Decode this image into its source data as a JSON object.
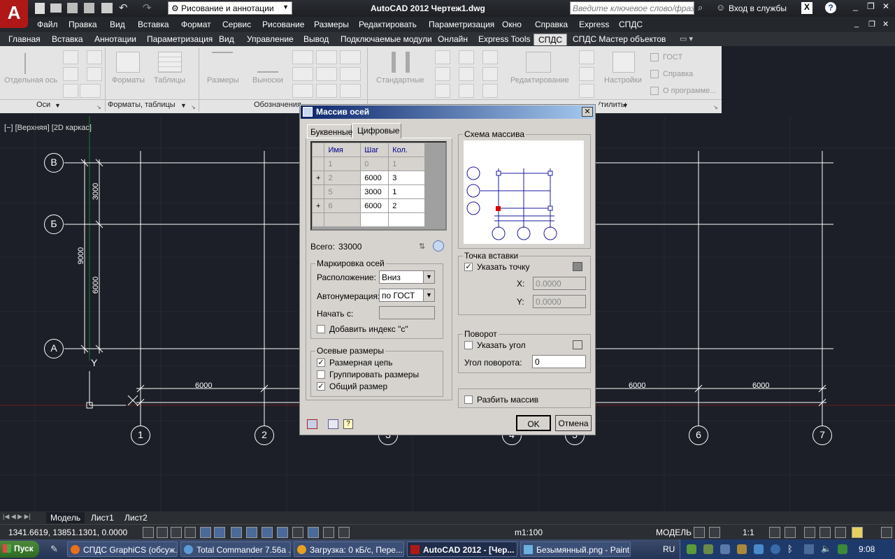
{
  "app": {
    "title": "AutoCAD 2012   Чертеж1.dwg",
    "workspace": "Рисование и аннотации",
    "search_placeholder": "Введите ключевое слово/фразу",
    "login": "Вход в службы"
  },
  "menu": [
    "Файл",
    "Правка",
    "Вид",
    "Вставка",
    "Формат",
    "Сервис",
    "Рисование",
    "Размеры",
    "Редактировать",
    "Параметризация",
    "Окно",
    "Справка",
    "Express",
    "СПДС"
  ],
  "ribbon_tabs": [
    "Главная",
    "Вставка",
    "Аннотации",
    "Параметризация",
    "Вид",
    "Управление",
    "Вывод",
    "Подключаемые модули",
    "Онлайн",
    "Express Tools",
    "СПДС",
    "СПДС Мастер объектов"
  ],
  "ribbon": {
    "buttons": {
      "axis": "Отдельная ось",
      "formats": "Форматы",
      "tables": "Таблицы",
      "dims": "Размеры",
      "leaders": "Выноски",
      "standard": "Стандартные",
      "edit": "Редактирование",
      "settings": "Настройки",
      "gost": "ГОСТ",
      "help": "Справка",
      "about": "О программе..."
    },
    "panels": [
      "Оси",
      "Форматы, таблицы",
      "Обозначения",
      "Утилиты"
    ]
  },
  "viewport_label": "[−] [Верхняя] [2D каркас]",
  "drawing": {
    "row_axes": [
      "В",
      "Б",
      "А"
    ],
    "col_axes": [
      "1",
      "2",
      "3",
      "4",
      "5",
      "6",
      "7"
    ],
    "dim_texts": [
      "6000",
      "6000",
      "6000"
    ],
    "vert_dims": [
      "3000",
      "6000",
      "9000"
    ],
    "ucs_y": "Y"
  },
  "layout_tabs": [
    "Модель",
    "Лист1",
    "Лист2"
  ],
  "status": {
    "coords": "1341.6619, 13851.1301, 0.0000",
    "scale_label": "m1:100",
    "model": "МОДЕЛЬ",
    "anno_scale": "1:1"
  },
  "dialog": {
    "title": "Массив осей",
    "tabs": [
      "Буквенные",
      "Цифровые"
    ],
    "grid": {
      "headers": [
        "Имя",
        "Шаг",
        "Кол."
      ],
      "rows": [
        {
          "expand": "",
          "name": "1",
          "step": "0",
          "count": "1"
        },
        {
          "expand": "+",
          "name": "2",
          "step": "6000",
          "count": "3"
        },
        {
          "expand": "",
          "name": "5",
          "step": "3000",
          "count": "1"
        },
        {
          "expand": "+",
          "name": "6",
          "step": "6000",
          "count": "2"
        },
        {
          "expand": "",
          "name": "",
          "step": "",
          "count": ""
        }
      ]
    },
    "total_label": "Всего:",
    "total_value": "33000",
    "marking": {
      "title": "Маркировка осей",
      "position_label": "Расположение:",
      "position_value": "Вниз",
      "autonum_label": "Автонумерация:",
      "autonum_value": "по ГОСТ",
      "start_label": "Начать с:",
      "add_index_label": "Добавить индекс \"с\""
    },
    "dims": {
      "title": "Осевые размеры",
      "chain": "Размерная цепь",
      "group": "Группировать размеры",
      "overall": "Общий размер"
    },
    "scheme_title": "Схема массива",
    "insert": {
      "title": "Точка вставки",
      "specify": "Указать точку",
      "x_label": "X:",
      "x_value": "0.0000",
      "y_label": "Y:",
      "y_value": "0.0000"
    },
    "rotation": {
      "title": "Поворот",
      "specify": "Указать угол",
      "angle_label": "Угол поворота:",
      "angle_value": "0"
    },
    "explode": "Разбить массив",
    "ok": "OK",
    "cancel": "Отмена"
  },
  "taskbar": {
    "start": "Пуск",
    "tasks": [
      "СПДС GraphiCS (обсуж...",
      "Total Commander 7.56a ...",
      "Загрузка: 0 кБ/с, Пере...",
      "AutoCAD 2012 - [Чер...",
      "Безымянный.png - Paint"
    ],
    "lang": "RU",
    "clock": "9:08"
  }
}
